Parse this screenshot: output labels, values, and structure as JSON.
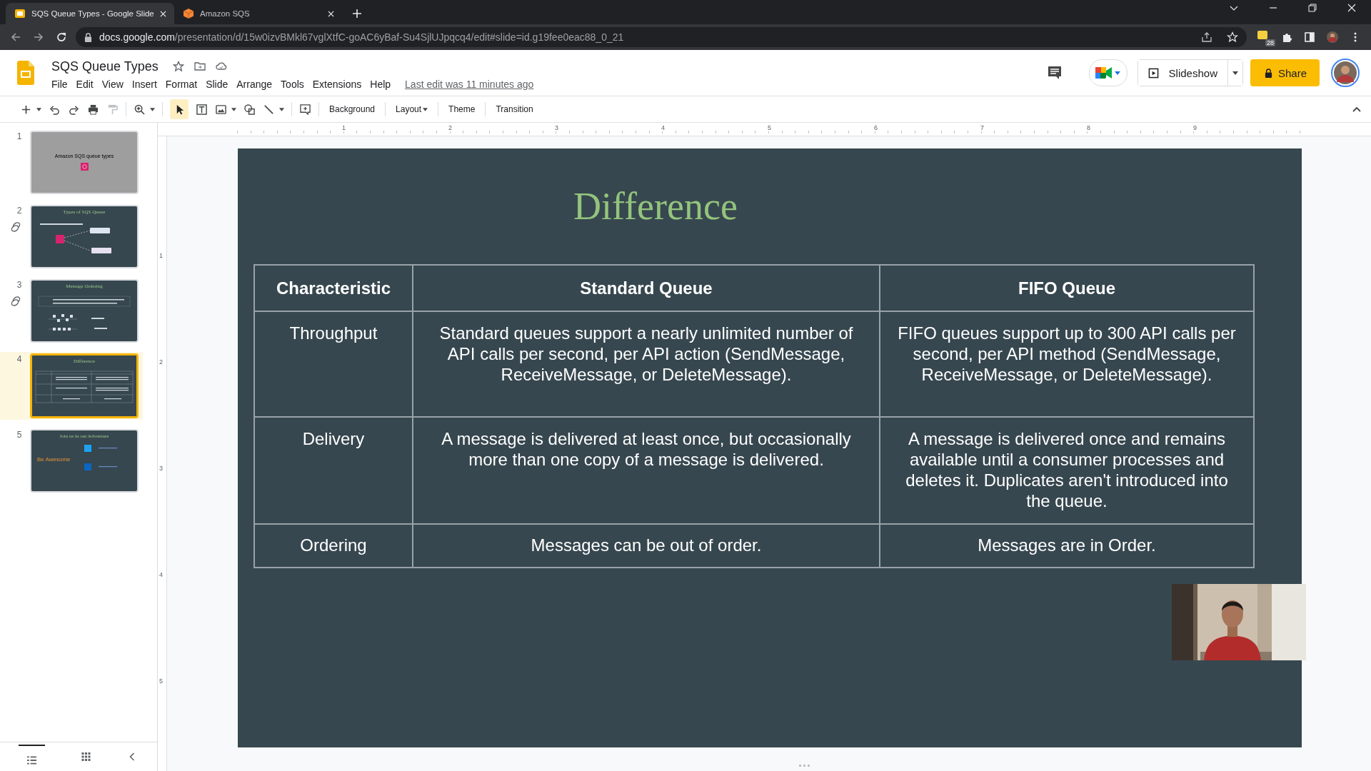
{
  "browser": {
    "tabs": [
      {
        "title": "SQS Queue Types - Google Slide",
        "selected": true
      },
      {
        "title": "Amazon SQS",
        "selected": false
      }
    ],
    "url_host": "docs.google.com",
    "url_path": "/presentation/d/15w0izvBMkl67vglXtfC-goAC6yBaf-Su4SjlUJpqcq4/edit#slide=id.g19fee0eac88_0_21",
    "extension_badge": "28"
  },
  "app": {
    "doc_title": "SQS Queue Types",
    "menu": [
      "File",
      "Edit",
      "View",
      "Insert",
      "Format",
      "Slide",
      "Arrange",
      "Tools",
      "Extensions",
      "Help"
    ],
    "last_edit": "Last edit was 11 minutes ago",
    "slideshow_button": "Slideshow",
    "share_button": "Share"
  },
  "toolbar": {
    "buttons": [
      {
        "label": "Background",
        "dropdown": false
      },
      {
        "label": "Layout",
        "dropdown": true
      },
      {
        "label": "Theme",
        "dropdown": false
      },
      {
        "label": "Transition",
        "dropdown": false
      }
    ]
  },
  "ruler": {
    "horizontal": [
      "1",
      "2",
      "3",
      "4",
      "5",
      "6",
      "7",
      "8",
      "9"
    ],
    "vertical": [
      "1",
      "2",
      "3",
      "4",
      "5"
    ]
  },
  "filmstrip": [
    {
      "number": "1",
      "title": "Amazon SQS queue types",
      "kind": "title",
      "selected": false,
      "linked": false
    },
    {
      "number": "2",
      "title": "Types of SQS Queue",
      "kind": "diagram",
      "selected": false,
      "linked": true
    },
    {
      "number": "3",
      "title": "Message Ordering",
      "kind": "ordering",
      "selected": false,
      "linked": true
    },
    {
      "number": "4",
      "title": "Difference",
      "kind": "table",
      "selected": true,
      "linked": false
    },
    {
      "number": "5",
      "title": "Join us in our Adventure",
      "subtitle": "Be Awesome",
      "kind": "social",
      "selected": false,
      "linked": false
    }
  ],
  "slide": {
    "title": "Difference",
    "table": {
      "columns": [
        "Characteristic",
        "Standard Queue",
        "FIFO Queue"
      ],
      "rows": [
        {
          "cells": [
            "Throughput",
            "Standard queues support a nearly unlimited number of API calls per second, per API action (SendMessage, ReceiveMessage, or DeleteMessage).",
            "FIFO queues support up to 300 API calls per second, per API method (SendMessage, ReceiveMessage, or DeleteMessage)."
          ]
        },
        {
          "cells": [
            "Delivery",
            "A message is delivered at least once, but occasionally more than one copy of a message is delivered.",
            "A message is delivered once and remains available until a consumer processes and deletes it. Duplicates aren't introduced into the queue."
          ]
        },
        {
          "cells": [
            "Ordering",
            "Messages can be out of order.",
            "Messages are in Order."
          ]
        }
      ]
    }
  }
}
